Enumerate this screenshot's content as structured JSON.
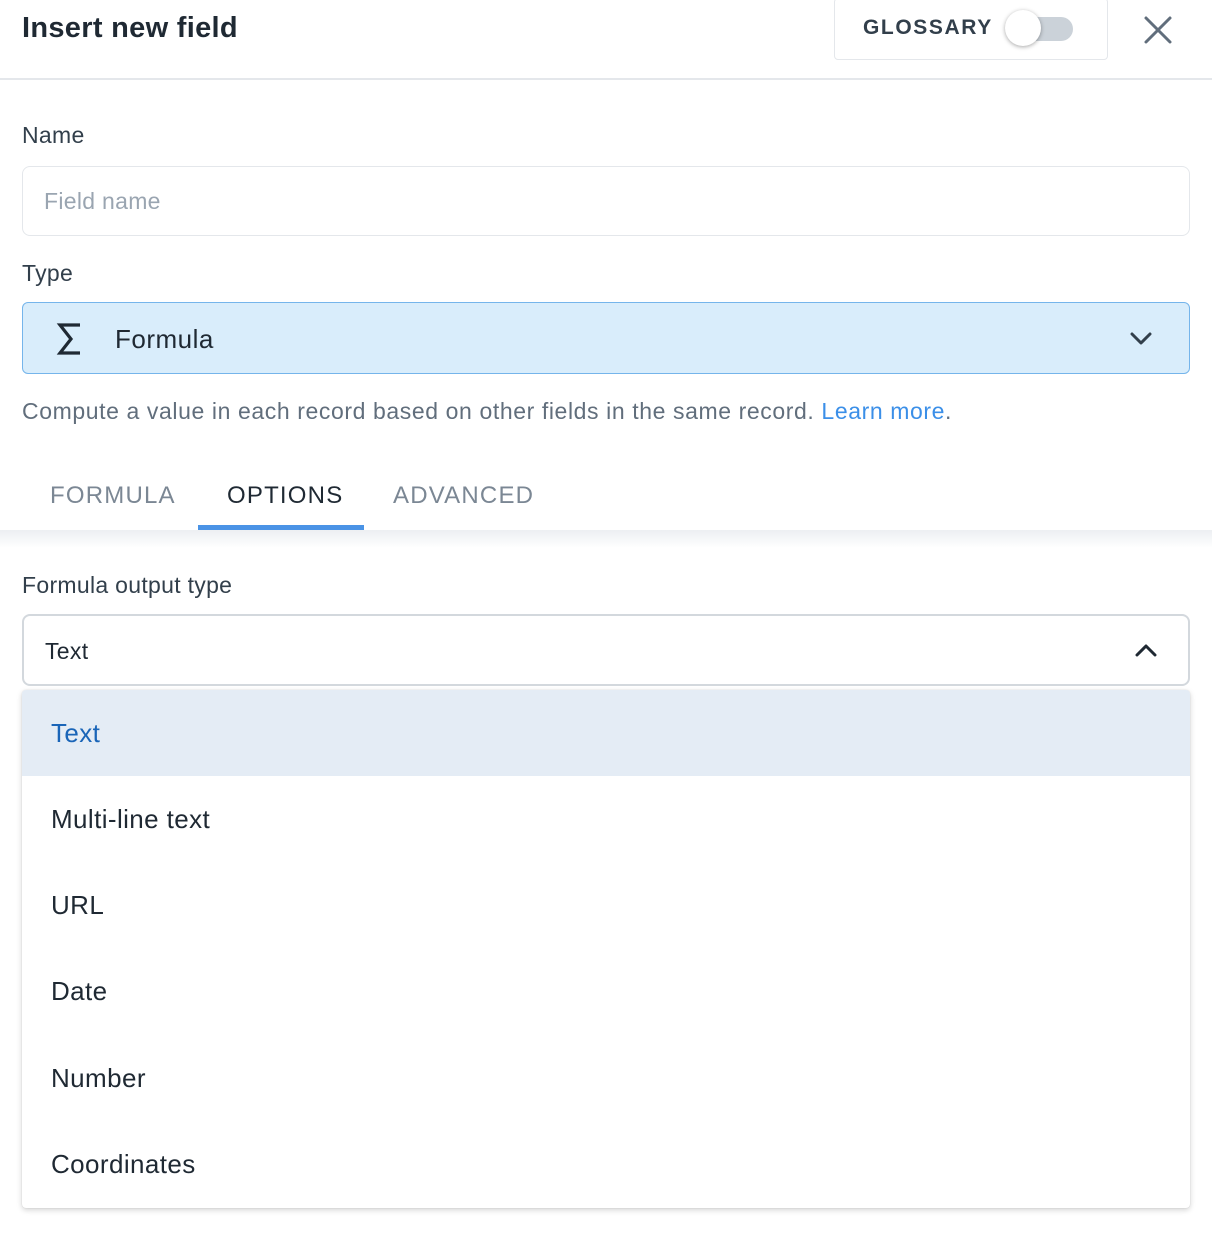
{
  "header": {
    "title": "Insert new field",
    "glossary_label": "GLOSSARY",
    "glossary_enabled": false
  },
  "form": {
    "name_label": "Name",
    "name_placeholder": "Field name",
    "name_value": "",
    "type_label": "Type",
    "type_value": "Formula",
    "type_icon": "sigma-icon",
    "help_text": "Compute a value in each record based on other fields in the same record.",
    "help_link": "Learn more",
    "help_suffix": "."
  },
  "tabs": [
    {
      "label": "FORMULA",
      "active": false
    },
    {
      "label": "OPTIONS",
      "active": true
    },
    {
      "label": "ADVANCED",
      "active": false
    }
  ],
  "options": {
    "output_type_label": "Formula output type",
    "output_type_value": "Text",
    "dropdown_items": [
      {
        "label": "Text",
        "selected": true
      },
      {
        "label": "Multi-line text",
        "selected": false
      },
      {
        "label": "URL",
        "selected": false
      },
      {
        "label": "Date",
        "selected": false
      },
      {
        "label": "Number",
        "selected": false
      },
      {
        "label": "Coordinates",
        "selected": false
      }
    ]
  },
  "colors": {
    "accent": "#4a93e6",
    "link": "#3b8fe8",
    "type_select_bg": "#d9edfb",
    "selected_item_bg": "#e4ecf5",
    "selected_item_text": "#1a65b8"
  }
}
